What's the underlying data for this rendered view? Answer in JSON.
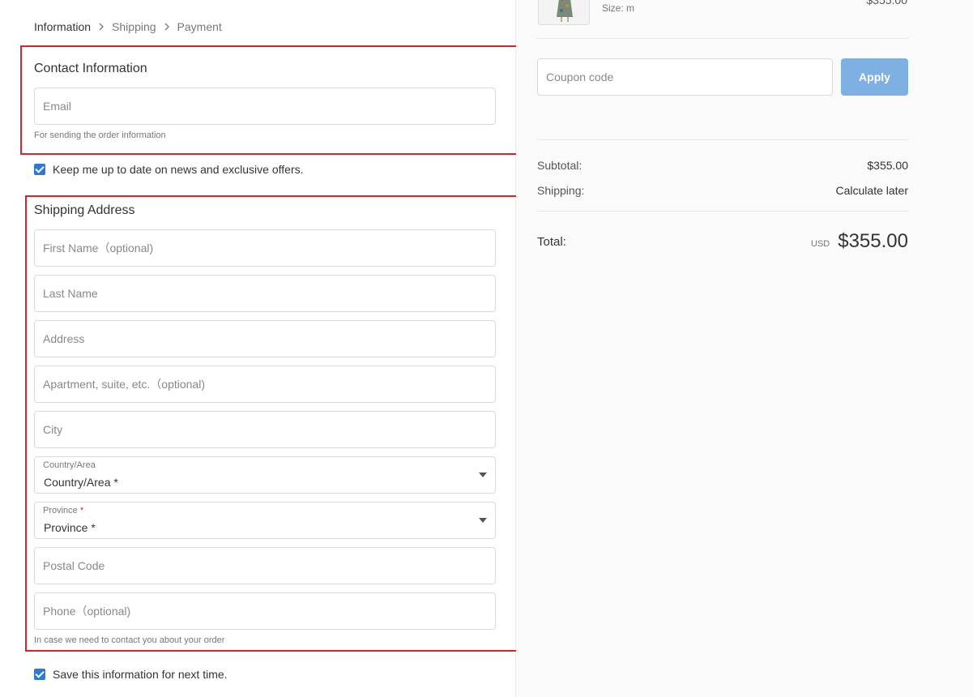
{
  "breadcrumb": {
    "steps": [
      "Information",
      "Shipping",
      "Payment"
    ]
  },
  "contact": {
    "title": "Contact Information",
    "email_placeholder": "Email",
    "email_helper": "For sending the order information"
  },
  "newsletter": {
    "label": "Keep me up to date on news and exclusive offers.",
    "checked": true
  },
  "shipping": {
    "title": "Shipping Address",
    "first_name_placeholder": "First Name（optional)",
    "last_name_placeholder": "Last Name",
    "address_placeholder": "Address",
    "apartment_placeholder": "Apartment, suite, etc.（optional)",
    "city_placeholder": "City",
    "country_label": "Country/Area",
    "country_value": "Country/Area *",
    "province_label": "Province",
    "province_required_mark": "*",
    "province_value": "Province *",
    "postal_placeholder": "Postal Code",
    "phone_placeholder": "Phone（optional)",
    "phone_helper": "In case we need to contact you about your order"
  },
  "save_info": {
    "label": "Save this information for next time.",
    "checked": true
  },
  "summary": {
    "item_size_label": "Size:  m",
    "item_price": "$355.00",
    "coupon_placeholder": "Coupon code",
    "apply_label": "Apply",
    "subtotal_label": "Subtotal:",
    "subtotal_value": "$355.00",
    "shipping_label": "Shipping:",
    "shipping_value": "Calculate later",
    "total_label": "Total:",
    "currency": "USD",
    "total_value": "$355.00"
  },
  "colors": {
    "accent": "#2c7ad6",
    "apply_button": "#7fb0e3",
    "highlight_outline": "#d9232a"
  }
}
